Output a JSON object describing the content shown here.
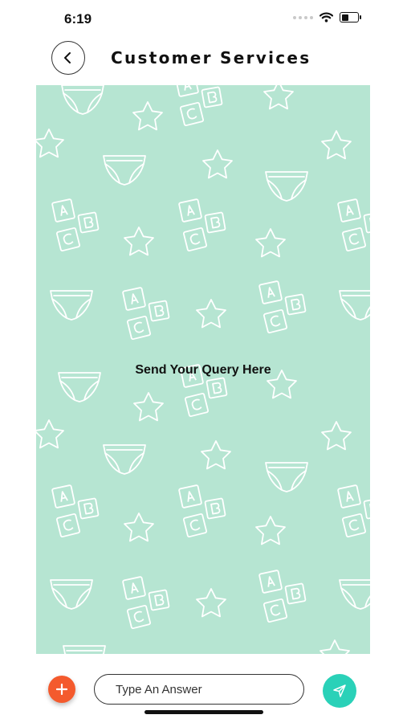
{
  "status_bar": {
    "time": "6:19",
    "icons": [
      "signal-icon",
      "wifi-icon",
      "battery-icon"
    ]
  },
  "header": {
    "back_icon": "chevron-left-icon",
    "title": "Customer Services"
  },
  "chat": {
    "background_color": "#b6e5d2",
    "pattern_motifs": [
      "star",
      "diaper",
      "abc-blocks"
    ],
    "empty_message": "Send Your Query Here"
  },
  "composer": {
    "add_icon": "plus-icon",
    "add_color": "#f45a2d",
    "placeholder": "Type An Answer",
    "send_icon": "send-icon",
    "send_color": "#2ad1b8"
  }
}
